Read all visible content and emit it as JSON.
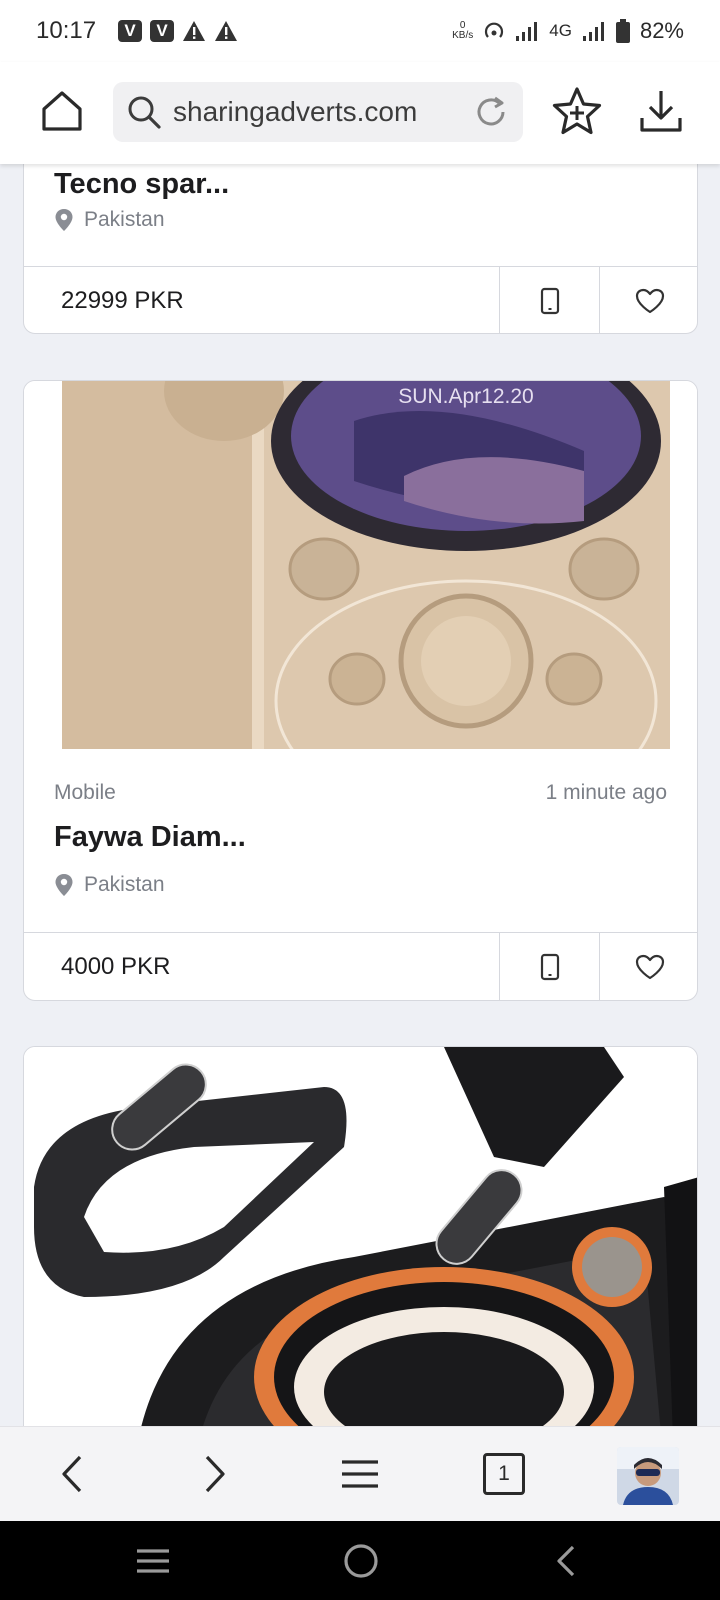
{
  "status_bar": {
    "time": "10:17",
    "kbps_value": "0",
    "kbps_unit": "KB/s",
    "network_type": "4G",
    "battery": "82%"
  },
  "browser": {
    "url": "sharingadverts.com"
  },
  "listings": [
    {
      "title": "Tecno spar...",
      "location": "Pakistan",
      "price": "22999 PKR"
    },
    {
      "image_text": "SUN.Apr12.20",
      "category": "Mobile",
      "time_ago": "1 minute ago",
      "title": "Faywa Diam...",
      "location": "Pakistan",
      "price": "4000 PKR"
    }
  ],
  "bottom_nav": {
    "tab_count": "1"
  },
  "colors": {
    "page_background": "#eef0f5",
    "card_border": "#d6d8de",
    "muted_text": "#7b7f87",
    "system_nav": "#000000"
  }
}
